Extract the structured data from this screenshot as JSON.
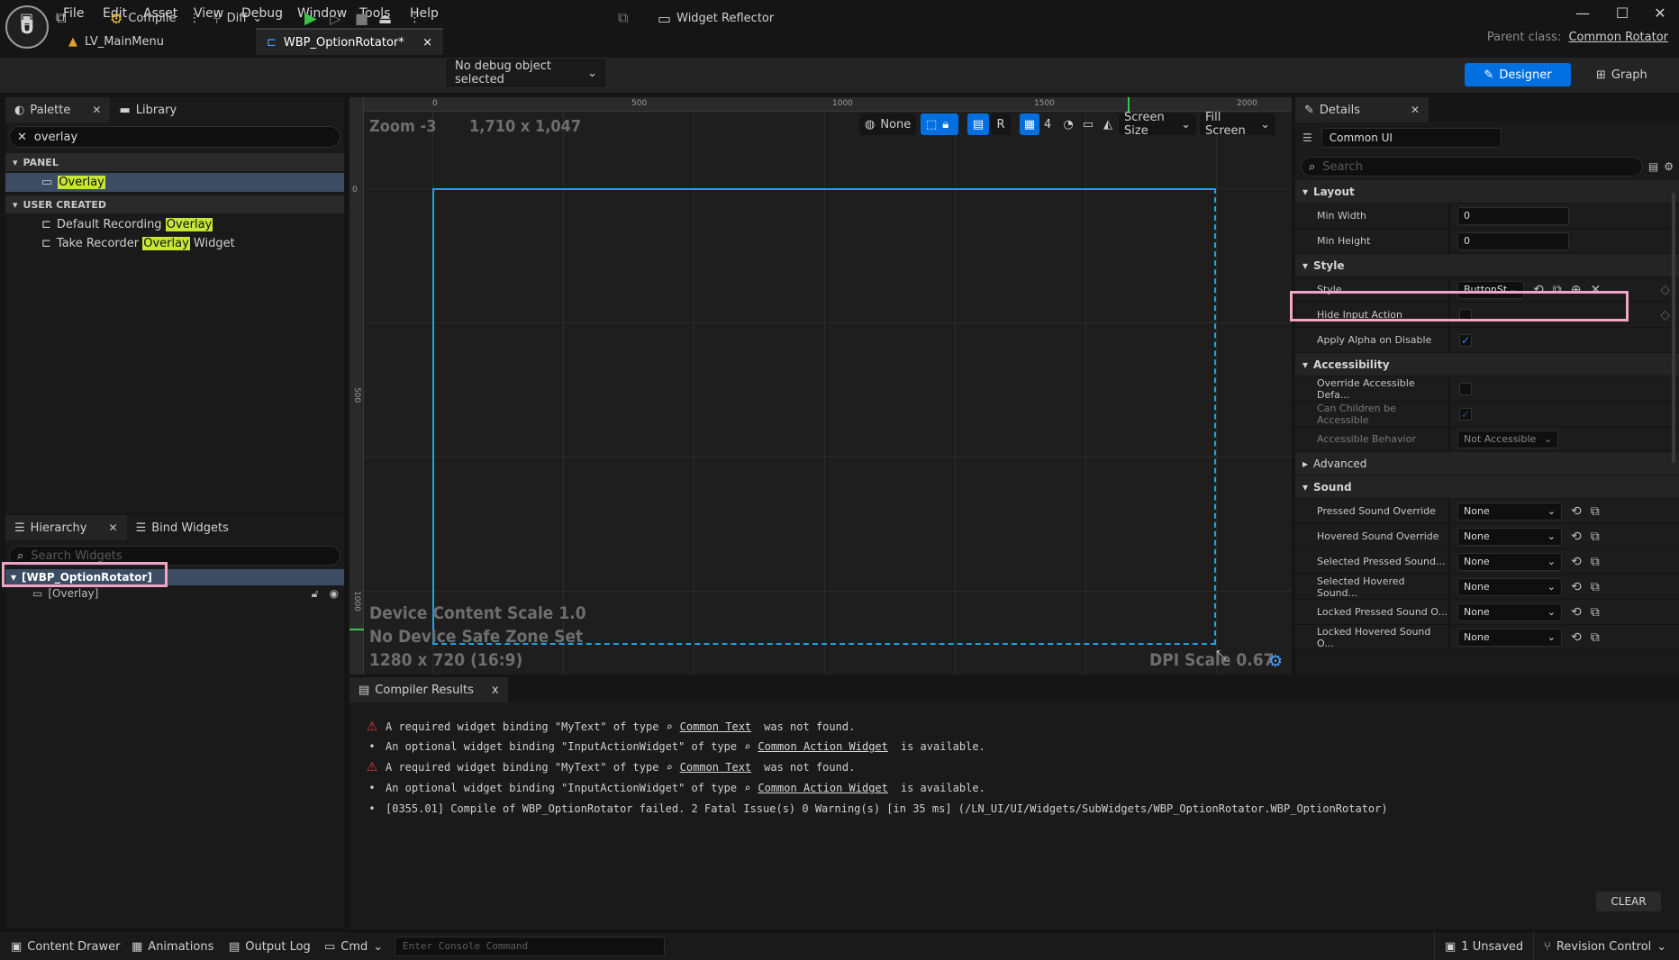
{
  "menu": [
    "File",
    "Edit",
    "Asset",
    "View",
    "Debug",
    "Window",
    "Tools",
    "Help"
  ],
  "tabs": [
    {
      "label": "LV_MainMenu"
    },
    {
      "label": "WBP_OptionRotator*",
      "close": "×"
    }
  ],
  "parent_class": {
    "label": "Parent class:",
    "value": "Common Rotator"
  },
  "window_controls": {
    "minimize": "—",
    "maximize": "☐",
    "close": "✕"
  },
  "toolbar": {
    "compile": "Compile",
    "diff": "Diff",
    "debug_object": "No debug object selected",
    "widget_reflector": "Widget Reflector",
    "designer": "Designer",
    "graph": "Graph"
  },
  "palette": {
    "tab": "Palette",
    "library_tab": "Library",
    "search_value": "overlay",
    "categories": [
      {
        "name": "PANEL",
        "items": [
          {
            "prefix": "",
            "highlight": "Overlay",
            "suffix": ""
          }
        ]
      },
      {
        "name": "USER CREATED",
        "items": [
          {
            "prefix": "Default Recording ",
            "highlight": "Overlay",
            "suffix": ""
          },
          {
            "prefix": "Take Recorder ",
            "highlight": "Overlay",
            "suffix": " Widget"
          }
        ]
      }
    ]
  },
  "hierarchy": {
    "tab": "Hierarchy",
    "bind_tab": "Bind Widgets",
    "search_placeholder": "Search Widgets",
    "root": "[WBP_OptionRotator]",
    "child": "[Overlay]"
  },
  "viewport": {
    "zoom": "Zoom -3",
    "size": "1,710 x 1,047",
    "none_label": "None",
    "r_label": "R",
    "grid_count": "4",
    "screen_size": "Screen Size",
    "fill_screen": "Fill Screen",
    "device_content_scale": "Device Content Scale 1.0",
    "safe_zone": "No Device Safe Zone Set",
    "resolution": "1280 x 720 (16:9)",
    "dpi_scale": "DPI Scale 0.67",
    "ruler_top": [
      "0",
      "500",
      "1000",
      "1500",
      "2000"
    ],
    "ruler_left": [
      "0",
      "500",
      "1000"
    ]
  },
  "details": {
    "tab": "Details",
    "object_name": "Common UI",
    "search_placeholder": "Search",
    "layout": {
      "title": "Layout",
      "min_width_label": "Min Width",
      "min_width": "0",
      "min_height_label": "Min Height",
      "min_height": "0"
    },
    "style": {
      "title": "Style",
      "style_label": "Style",
      "style_value": "ButtonSt",
      "hide_input_action": "Hide Input Action",
      "apply_alpha": "Apply Alpha on Disable"
    },
    "accessibility": {
      "title": "Accessibility",
      "override": "Override Accessible Defa...",
      "can_children": "Can Children be Accessible",
      "behavior_label": "Accessible Behavior",
      "behavior_value": "Not Accessible"
    },
    "advanced": {
      "title": "Advanced"
    },
    "sound": {
      "title": "Sound",
      "rows": [
        {
          "label": "Pressed Sound Override",
          "value": "None"
        },
        {
          "label": "Hovered Sound Override",
          "value": "None"
        },
        {
          "label": "Selected Pressed Sound...",
          "value": "None"
        },
        {
          "label": "Selected Hovered Sound...",
          "value": "None"
        },
        {
          "label": "Locked Pressed Sound O...",
          "value": "None"
        },
        {
          "label": "Locked Hovered Sound O...",
          "value": "None"
        }
      ]
    }
  },
  "compiler": {
    "tab": "Compiler Results",
    "close": "x",
    "clear": "CLEAR",
    "messages": [
      {
        "type": "error",
        "pre": "A required widget binding \"MyText\" of type",
        "link": "Common Text",
        "post": "was not found."
      },
      {
        "type": "info",
        "pre": "An optional widget binding \"InputActionWidget\" of type",
        "link": "Common Action Widget",
        "post": "is available."
      },
      {
        "type": "error",
        "pre": "A required widget binding \"MyText\" of type",
        "link": "Common Text",
        "post": "was not found."
      },
      {
        "type": "info",
        "pre": "An optional widget binding \"InputActionWidget\" of type",
        "link": "Common Action Widget",
        "post": "is available."
      },
      {
        "type": "info",
        "pre": "[0355.01] Compile of WBP_OptionRotator failed. 2 Fatal Issue(s) 0 Warning(s) [in 35 ms] (/LN_UI/UI/Widgets/SubWidgets/WBP_OptionRotator.WBP_OptionRotator)",
        "link": "",
        "post": ""
      }
    ]
  },
  "statusbar": {
    "content_drawer": "Content Drawer",
    "animations": "Animations",
    "output_log": "Output Log",
    "cmd": "Cmd",
    "console_placeholder": "Enter Console Command",
    "unsaved": "1 Unsaved",
    "revision_control": "Revision Control"
  },
  "colors": {
    "accent": "#0070e0",
    "selection": "#1da4e6",
    "highlight": "#c8e637",
    "annotation": "#f2a5c2",
    "error": "#e23b3b"
  }
}
